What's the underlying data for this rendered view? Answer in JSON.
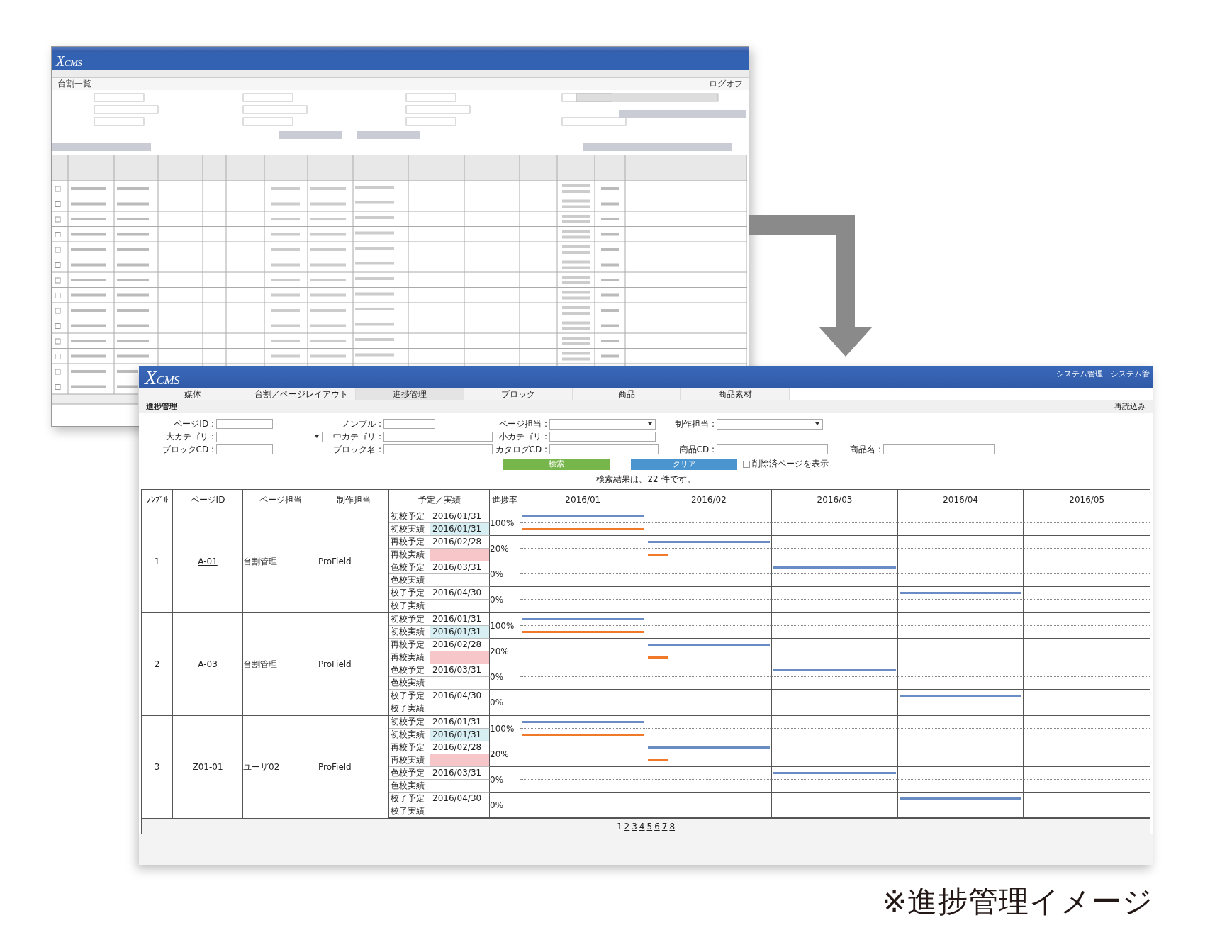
{
  "back_window": {
    "logo": "XCMS",
    "title": "台割一覧",
    "logout": "ログオフ"
  },
  "front_window": {
    "logo": "XCMS",
    "user": "システム管理　システム管",
    "nav": [
      {
        "label": "媒体",
        "selected": false
      },
      {
        "label": "台割／ページレイアウト",
        "selected": false
      },
      {
        "label": "進捗管理",
        "selected": true
      },
      {
        "label": "ブロック",
        "selected": false
      },
      {
        "label": "商品",
        "selected": false
      },
      {
        "label": "商品素材",
        "selected": false
      }
    ],
    "page_title": "進捗管理",
    "reload": "再読込み",
    "form_rows": [
      [
        {
          "label": "ページID :",
          "kind": "input"
        },
        {
          "label": "ノンブル :",
          "kind": "input"
        },
        {
          "label": "ページ担当 :",
          "kind": "select"
        },
        {
          "label": "制作担当 :",
          "kind": "select"
        }
      ],
      [
        {
          "label": "大カテゴリ :",
          "kind": "select"
        },
        {
          "label": "中カテゴリ :",
          "kind": "input"
        },
        {
          "label": "小カテゴリ :",
          "kind": "input"
        }
      ],
      [
        {
          "label": "ブロックCD :",
          "kind": "input"
        },
        {
          "label": "ブロック名 :",
          "kind": "input"
        },
        {
          "label": "カタログCD :",
          "kind": "input"
        },
        {
          "label": "商品CD :",
          "kind": "input"
        },
        {
          "label": "商品名 :",
          "kind": "input"
        }
      ]
    ],
    "search_button": "検索",
    "clear_button": "クリア",
    "show_deleted": {
      "label": "削除済ページを表示",
      "checked": false
    },
    "result": "検索結果は、22 件です。",
    "table": {
      "columns": [
        "ﾉﾝﾌﾞﾙ",
        "ページID",
        "ページ担当",
        "制作担当",
        "予定／実績",
        "進捗率",
        "2016/01",
        "2016/02",
        "2016/03",
        "2016/04",
        "2016/05"
      ],
      "rows": [
        {
          "no": "1",
          "page_id": "A-01",
          "page_owner": "台割管理",
          "producer": "ProField",
          "progress": [
            "100%",
            "20%",
            "0%",
            "0%"
          ],
          "schedule": [
            {
              "label": "初校予定",
              "date": "2016/01/31",
              "kind": "plan",
              "timeline": [
                {
                  "bar": true,
                  "level": 1
                },
                {
                  "bar": false
                },
                {
                  "bar": false
                },
                {
                  "bar": false
                },
                {
                  "bar": false
                }
              ]
            },
            {
              "label": "初校実績",
              "date": "2016/01/31",
              "kind": "actual",
              "done": true,
              "overdue": false,
              "timeline": [
                {
                  "bar": true,
                  "level": 1
                },
                {
                  "bar": false
                },
                {
                  "bar": false
                },
                {
                  "bar": false
                },
                {
                  "bar": false
                }
              ]
            },
            {
              "label": "再校予定",
              "date": "2016/02/28",
              "kind": "plan",
              "timeline": [
                {
                  "bar": false
                },
                {
                  "bar": true,
                  "level": 1
                },
                {
                  "bar": false
                },
                {
                  "bar": false
                },
                {
                  "bar": false
                }
              ]
            },
            {
              "label": "再校実績",
              "kind": "actual",
              "done": false,
              "overdue": true,
              "timeline": [
                {
                  "bar": false
                },
                {
                  "bar": true,
                  "level": 0.17
                },
                {
                  "bar": false
                },
                {
                  "bar": false
                },
                {
                  "bar": false
                }
              ]
            },
            {
              "label": "色校予定",
              "date": "2016/03/31",
              "kind": "plan",
              "timeline": [
                {
                  "bar": false
                },
                {
                  "bar": false
                },
                {
                  "bar": true,
                  "level": 1
                },
                {
                  "bar": false
                },
                {
                  "bar": false
                }
              ]
            },
            {
              "label": "色校実績",
              "kind": "actual",
              "done": false,
              "overdue": false,
              "timeline": [
                {
                  "bar": false
                },
                {
                  "bar": false
                },
                {
                  "bar": false
                },
                {
                  "bar": false
                },
                {
                  "bar": false
                }
              ]
            },
            {
              "label": "校了予定",
              "date": "2016/04/30",
              "kind": "plan",
              "timeline": [
                {
                  "bar": false
                },
                {
                  "bar": false
                },
                {
                  "bar": false
                },
                {
                  "bar": true,
                  "level": 1
                },
                {
                  "bar": false
                }
              ]
            },
            {
              "label": "校了実績",
              "kind": "actual",
              "done": false,
              "overdue": false,
              "timeline": [
                {
                  "bar": false
                },
                {
                  "bar": false
                },
                {
                  "bar": false
                },
                {
                  "bar": false
                },
                {
                  "bar": false
                }
              ]
            }
          ]
        },
        {
          "no": "2",
          "page_id": "A-03",
          "page_owner": "台割管理",
          "producer": "ProField",
          "progress": [
            "100%",
            "20%",
            "0%",
            "0%"
          ],
          "schedule": [
            {
              "label": "初校予定",
              "date": "2016/01/31",
              "kind": "plan",
              "timeline": [
                {
                  "bar": true,
                  "level": 1
                },
                {
                  "bar": false
                },
                {
                  "bar": false
                },
                {
                  "bar": false
                },
                {
                  "bar": false
                }
              ]
            },
            {
              "label": "初校実績",
              "date": "2016/01/31",
              "kind": "actual",
              "done": true,
              "overdue": false,
              "timeline": [
                {
                  "bar": true,
                  "level": 1
                },
                {
                  "bar": false
                },
                {
                  "bar": false
                },
                {
                  "bar": false
                },
                {
                  "bar": false
                }
              ]
            },
            {
              "label": "再校予定",
              "date": "2016/02/28",
              "kind": "plan",
              "timeline": [
                {
                  "bar": false
                },
                {
                  "bar": true,
                  "level": 1
                },
                {
                  "bar": false
                },
                {
                  "bar": false
                },
                {
                  "bar": false
                }
              ]
            },
            {
              "label": "再校実績",
              "kind": "actual",
              "done": false,
              "overdue": true,
              "timeline": [
                {
                  "bar": false
                },
                {
                  "bar": true,
                  "level": 0.17
                },
                {
                  "bar": false
                },
                {
                  "bar": false
                },
                {
                  "bar": false
                }
              ]
            },
            {
              "label": "色校予定",
              "date": "2016/03/31",
              "kind": "plan",
              "timeline": [
                {
                  "bar": false
                },
                {
                  "bar": false
                },
                {
                  "bar": true,
                  "level": 1
                },
                {
                  "bar": false
                },
                {
                  "bar": false
                }
              ]
            },
            {
              "label": "色校実績",
              "kind": "actual",
              "done": false,
              "overdue": false,
              "timeline": [
                {
                  "bar": false
                },
                {
                  "bar": false
                },
                {
                  "bar": false
                },
                {
                  "bar": false
                },
                {
                  "bar": false
                }
              ]
            },
            {
              "label": "校了予定",
              "date": "2016/04/30",
              "kind": "plan",
              "timeline": [
                {
                  "bar": false
                },
                {
                  "bar": false
                },
                {
                  "bar": false
                },
                {
                  "bar": true,
                  "level": 1
                },
                {
                  "bar": false
                }
              ]
            },
            {
              "label": "校了実績",
              "kind": "actual",
              "done": false,
              "overdue": false,
              "timeline": [
                {
                  "bar": false
                },
                {
                  "bar": false
                },
                {
                  "bar": false
                },
                {
                  "bar": false
                },
                {
                  "bar": false
                }
              ]
            }
          ]
        },
        {
          "no": "3",
          "page_id": "Z01-01",
          "page_owner": "ユーザ02",
          "producer": "ProField",
          "progress": [
            "100%",
            "20%",
            "0%",
            "0%"
          ],
          "schedule": [
            {
              "label": "初校予定",
              "date": "2016/01/31",
              "kind": "plan",
              "timeline": [
                {
                  "bar": true,
                  "level": 1
                },
                {
                  "bar": false
                },
                {
                  "bar": false
                },
                {
                  "bar": false
                },
                {
                  "bar": false
                }
              ]
            },
            {
              "label": "初校実績",
              "date": "2016/01/31",
              "kind": "actual",
              "done": true,
              "overdue": false,
              "timeline": [
                {
                  "bar": true,
                  "level": 1
                },
                {
                  "bar": false
                },
                {
                  "bar": false
                },
                {
                  "bar": false
                },
                {
                  "bar": false
                }
              ]
            },
            {
              "label": "再校予定",
              "date": "2016/02/28",
              "kind": "plan",
              "timeline": [
                {
                  "bar": false
                },
                {
                  "bar": true,
                  "level": 1
                },
                {
                  "bar": false
                },
                {
                  "bar": false
                },
                {
                  "bar": false
                }
              ]
            },
            {
              "label": "再校実績",
              "kind": "actual",
              "done": false,
              "overdue": true,
              "timeline": [
                {
                  "bar": false
                },
                {
                  "bar": true,
                  "level": 0.17
                },
                {
                  "bar": false
                },
                {
                  "bar": false
                },
                {
                  "bar": false
                }
              ]
            },
            {
              "label": "色校予定",
              "date": "2016/03/31",
              "kind": "plan",
              "timeline": [
                {
                  "bar": false
                },
                {
                  "bar": false
                },
                {
                  "bar": true,
                  "level": 1
                },
                {
                  "bar": false
                },
                {
                  "bar": false
                }
              ]
            },
            {
              "label": "色校実績",
              "kind": "actual",
              "done": false,
              "overdue": false,
              "timeline": [
                {
                  "bar": false
                },
                {
                  "bar": false
                },
                {
                  "bar": false
                },
                {
                  "bar": false
                },
                {
                  "bar": false
                }
              ]
            },
            {
              "label": "校了予定",
              "date": "2016/04/30",
              "kind": "plan",
              "timeline": [
                {
                  "bar": false
                },
                {
                  "bar": false
                },
                {
                  "bar": false
                },
                {
                  "bar": true,
                  "level": 1
                },
                {
                  "bar": false
                }
              ]
            },
            {
              "label": "校了実績",
              "kind": "actual",
              "done": false,
              "overdue": false,
              "timeline": [
                {
                  "bar": false
                },
                {
                  "bar": false
                },
                {
                  "bar": false
                },
                {
                  "bar": false
                },
                {
                  "bar": false
                }
              ]
            }
          ]
        }
      ]
    },
    "pages": [
      {
        "label": "1",
        "selected": true
      },
      {
        "label": "2",
        "selected": false
      },
      {
        "label": "3",
        "selected": false
      },
      {
        "label": "4",
        "selected": false
      },
      {
        "label": "5",
        "selected": false
      },
      {
        "label": "6",
        "selected": false
      },
      {
        "label": "7",
        "selected": false
      },
      {
        "label": "8",
        "selected": false
      }
    ]
  },
  "caption": "※進捗管理イメージ"
}
